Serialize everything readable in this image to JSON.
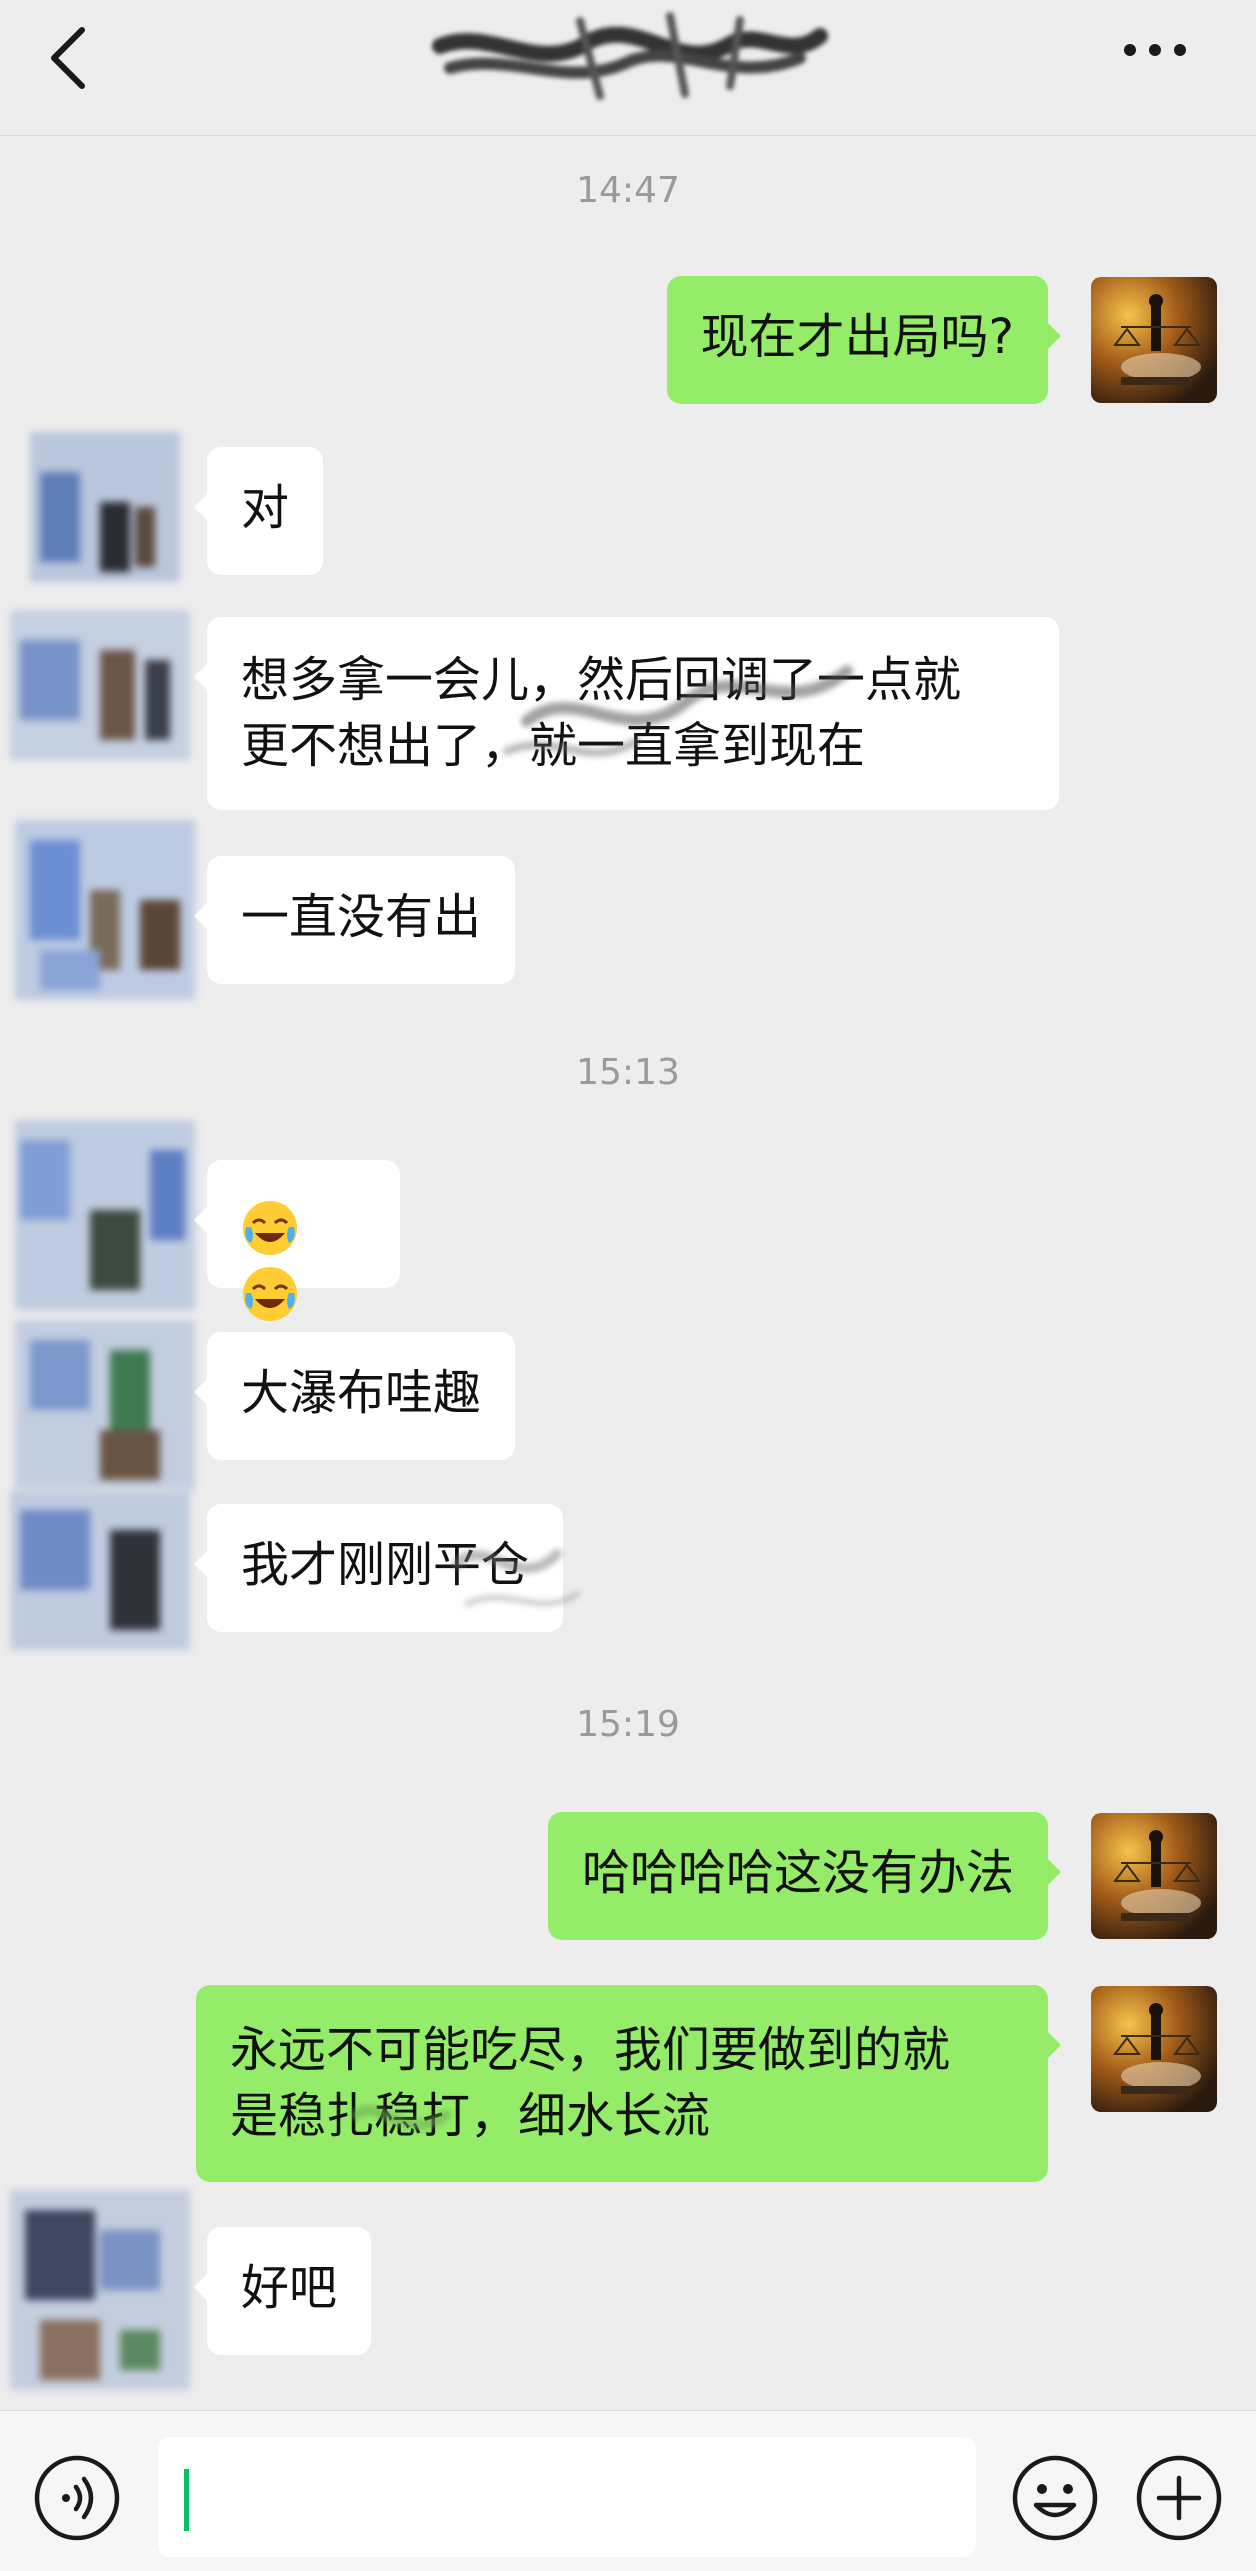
{
  "header": {
    "title_redacted": true
  },
  "timestamps": [
    "14:47",
    "15:13",
    "15:19"
  ],
  "messages": [
    {
      "side": "right",
      "text": "现在才出局吗?"
    },
    {
      "side": "left",
      "text": "对"
    },
    {
      "side": "left",
      "text": "想多拿一会儿，然后回调了一点就\n更不想出了，就一直拿到现在"
    },
    {
      "side": "left",
      "text": "一直没有出"
    },
    {
      "side": "left",
      "emoji": [
        "face-with-tears-of-joy",
        "face-with-tears-of-joy"
      ]
    },
    {
      "side": "left",
      "text": "大瀑布哇趣"
    },
    {
      "side": "left",
      "text": "我才刚刚平仓"
    },
    {
      "side": "right",
      "text": "哈哈哈哈这没有办法"
    },
    {
      "side": "right",
      "text": "永远不可能吃尽，我们要做到的就\n是稳扎稳打，细水长流"
    },
    {
      "side": "left",
      "text": "好吧"
    }
  ],
  "input": {
    "value": "",
    "placeholder": ""
  },
  "icons": {
    "back": "chevron-left-icon",
    "more": "more-dots-icon",
    "voice": "voice-icon",
    "emoji": "smiley-icon",
    "plus": "plus-circle-icon"
  },
  "colors": {
    "background": "#ededed",
    "self_bubble": "#95ec69",
    "other_bubble": "#ffffff",
    "caret": "#07c160"
  }
}
